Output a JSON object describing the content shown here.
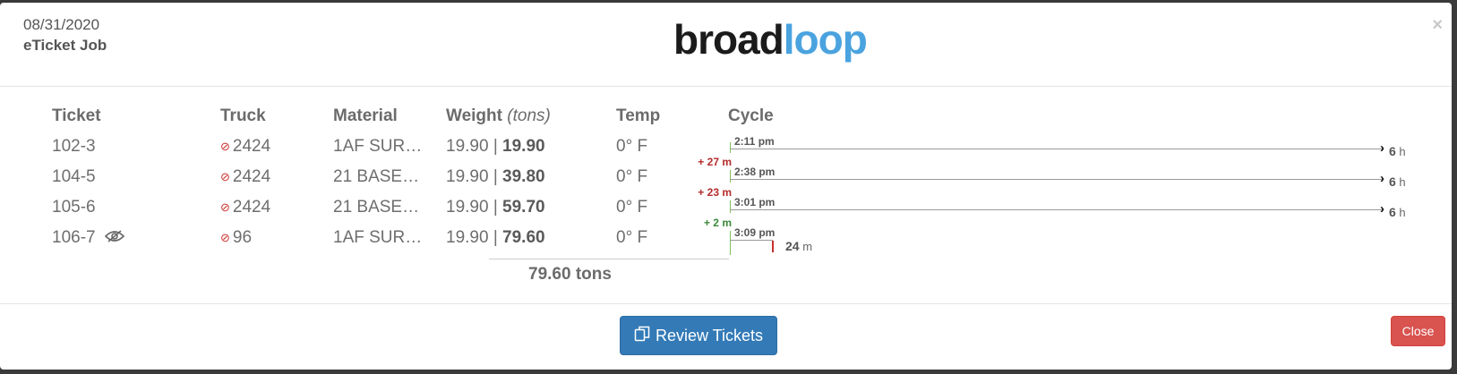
{
  "header": {
    "date": "08/31/2020",
    "job": "eTicket Job",
    "logo_dark": "broad",
    "logo_blue": "loop",
    "close_glyph": "×"
  },
  "columns": {
    "ticket": "Ticket",
    "truck": "Truck",
    "material": "Material",
    "weight": "Weight",
    "weight_unit": "(tons)",
    "temp": "Temp",
    "cycle": "Cycle"
  },
  "rows": [
    {
      "ticket": "102-3",
      "truck": "2424",
      "material": "1AF SUR…",
      "weight": "19.90 |",
      "cumulative": "19.90",
      "temp": "0° F",
      "cycle_time": "2:11 pm",
      "duration_value": "6",
      "duration_unit": "h"
    },
    {
      "ticket": "104-5",
      "truck": "2424",
      "material": "21 BASE…",
      "weight": "19.90 |",
      "cumulative": "39.80",
      "temp": "0° F",
      "cycle_time": "2:38 pm",
      "delta": "+ 27 m",
      "delta_color": "#b52b2b",
      "duration_value": "6",
      "duration_unit": "h"
    },
    {
      "ticket": "105-6",
      "truck": "2424",
      "material": "21 BASE…",
      "weight": "19.90 |",
      "cumulative": "59.70",
      "temp": "0° F",
      "cycle_time": "3:01 pm",
      "delta": "+ 23 m",
      "delta_color": "#b52b2b",
      "duration_value": "6",
      "duration_unit": "h"
    },
    {
      "ticket": "106-7",
      "truck": "96",
      "material": "1AF SUR…",
      "weight": "19.90 |",
      "cumulative": "79.60",
      "temp": "0° F",
      "cycle_time": "3:09 pm",
      "delta": "+ 2 m",
      "delta_color": "#3a8a3a",
      "duration_value": "24",
      "duration_unit": "m"
    }
  ],
  "icons": {
    "truck_status": "ban-icon",
    "ticket_viewed": "eye-slash-icon",
    "cycle_end": "chevron-right-icon",
    "review": "copy-icon"
  },
  "total": "79.60 tons",
  "footer": {
    "review_label": "Review Tickets",
    "close_label": "Close"
  },
  "colors": {
    "primary": "#337ab7",
    "danger": "#d9534f",
    "logo_blue": "#4aa3df"
  }
}
